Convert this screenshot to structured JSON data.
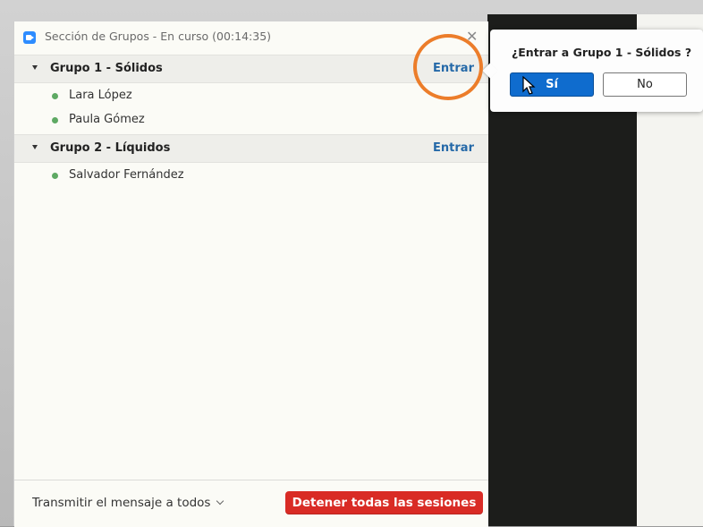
{
  "window": {
    "title": "Sección de Grupos - En curso (00:14:35)",
    "close_symbol": "✕"
  },
  "groups": [
    {
      "name": "Grupo 1 - Sólidos",
      "enter_label": "Entrar",
      "members": [
        "Lara López",
        "Paula Gómez"
      ]
    },
    {
      "name": "Grupo 2 - Líquidos",
      "enter_label": "Entrar",
      "members": [
        "Salvador Fernández"
      ]
    }
  ],
  "footer": {
    "broadcast_label": "Transmitir el mensaje a todos",
    "stop_all_label": "Detener todas las sesiones"
  },
  "popup": {
    "question": "¿Entrar a Grupo 1 - Sólidos ?",
    "yes_label": "Sí",
    "no_label": "No"
  },
  "colors": {
    "accent_blue": "#0f6cce",
    "link_blue": "#2569a8",
    "stop_red": "#d92b25",
    "member_dot_green": "#5ea963",
    "highlight_orange": "#ec7d2a"
  },
  "icons": {
    "app": "zoom-app-icon",
    "close": "close-icon",
    "group_toggle": "caret-down-icon",
    "broadcast_dropdown": "chevron-down-icon",
    "pointer": "mouse-cursor-icon"
  }
}
